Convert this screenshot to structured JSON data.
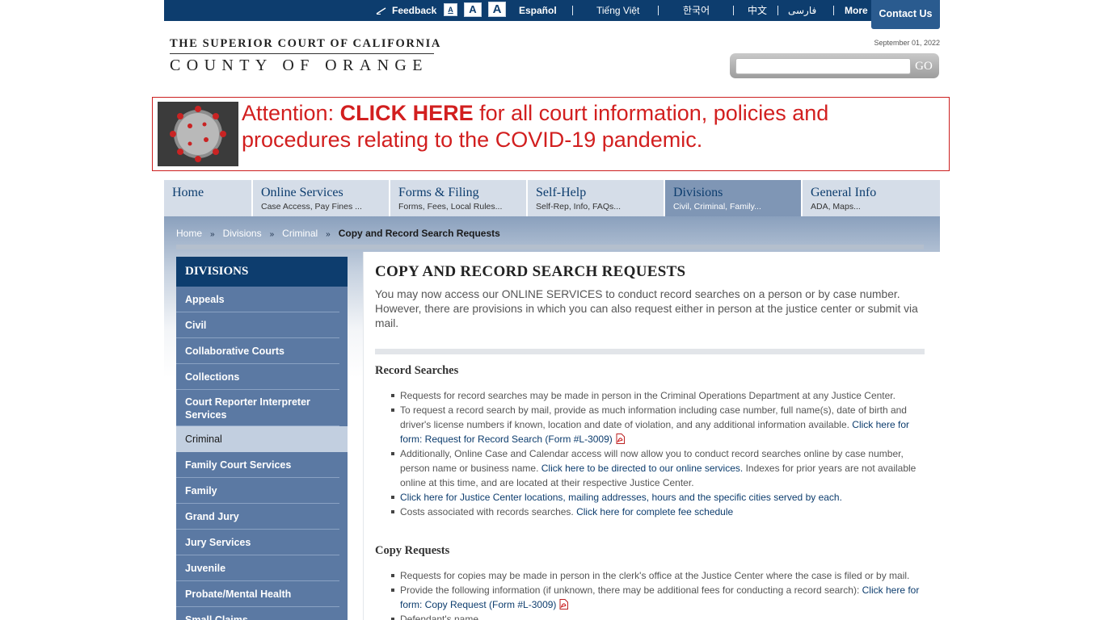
{
  "topbar": {
    "feedback": "Feedback",
    "font_small": "A",
    "font_medium": "A",
    "font_large": "A",
    "languages": [
      "Español",
      "Tiếng Việt",
      "한국어",
      "中文",
      "فارسی"
    ],
    "more": "More",
    "contact": "Contact Us"
  },
  "header": {
    "logo_top": "THE SUPERIOR COURT OF CALIFORNIA",
    "logo_bottom": "COUNTY OF ORANGE",
    "date": "September 01, 2022",
    "search_placeholder": "",
    "search_go": "GO"
  },
  "banner": {
    "prefix": "Attention: ",
    "link": "CLICK HERE",
    "suffix": " for all court information, policies and procedures relating to the COVID-19 pandemic."
  },
  "nav": {
    "tabs": [
      {
        "title": "Home",
        "sub": ""
      },
      {
        "title": "Online Services",
        "sub": "Case Access, Pay Fines ..."
      },
      {
        "title": "Forms & Filing",
        "sub": "Forms, Fees, Local Rules..."
      },
      {
        "title": "Self-Help",
        "sub": "Self-Rep, Info, FAQs..."
      },
      {
        "title": "Divisions",
        "sub": "Civil, Criminal, Family..."
      },
      {
        "title": "General Info",
        "sub": "ADA, Maps..."
      }
    ]
  },
  "breadcrumb": {
    "items": [
      "Home",
      "Divisions",
      "Criminal"
    ],
    "sep": "»",
    "current": "Copy and Record Search Requests"
  },
  "sidebar": {
    "heading": "DIVISIONS",
    "items": [
      "Appeals",
      "Civil",
      "Collaborative Courts",
      "Collections",
      "Court Reporter Interpreter Services",
      "Criminal",
      "Family Court Services",
      "Family",
      "Grand Jury",
      "Jury Services",
      "Juvenile",
      "Probate/Mental Health",
      "Small Claims"
    ]
  },
  "main": {
    "title": "COPY AND RECORD SEARCH REQUESTS",
    "intro": "You may now access our ONLINE SERVICES to conduct record searches on a person or by case number. However, there are provisions in which you can also request either in person at the justice center or submit via mail.",
    "record": {
      "heading": "Record Searches",
      "b1": "Requests for record searches may be made in person in the Criminal Operations Department at any Justice Center.",
      "b2_text": "To request a record search by mail, provide as much information including case number, full name(s), date of birth and driver's license numbers if known, location and date of violation, and any additional information available. ",
      "b2_link": "Click here for form: Request for Record Search (Form #L-3009)",
      "b3_text1": "Additionally, Online Case and Calendar access will now allow you to conduct record searches online by case number, person name or business name. ",
      "b3_link": "Click here to be directed to our online services.",
      "b3_text2": " Indexes for prior years are not available online at this time, and are located at their respective Justice Center.",
      "b4_link": "Click here for Justice Center locations, mailing addresses, hours and the specific cities served by each.",
      "b5_text": "Costs associated with records searches. ",
      "b5_link": "Click here for complete fee schedule"
    },
    "copy": {
      "heading": "Copy Requests",
      "b1": "Requests for copies may be made in person in the clerk's office at the Justice Center where the case is filed or by mail.",
      "b2_text": "Provide the following information (if unknown, there may be additional fees for conducting a record search): ",
      "b2_link": "Click here for form: Copy Request (Form #L-3009)",
      "b3": "Defendant's name"
    }
  }
}
